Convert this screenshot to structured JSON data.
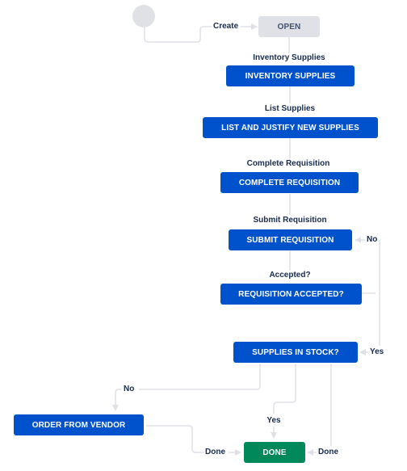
{
  "diagram": {
    "start_node": "start-circle",
    "statuses": {
      "open": {
        "label": "OPEN",
        "category": "todo"
      },
      "inventory": {
        "label": "INVENTORY SUPPLIES",
        "category": "inprogress"
      },
      "list": {
        "label": "LIST AND JUSTIFY NEW SUPPLIES",
        "category": "inprogress"
      },
      "complete": {
        "label": "COMPLETE REQUISITION",
        "category": "inprogress"
      },
      "submit": {
        "label": "SUBMIT REQUISITION",
        "category": "inprogress"
      },
      "accepted": {
        "label": "REQUISITION ACCEPTED?",
        "category": "inprogress"
      },
      "instock": {
        "label": "SUPPLIES IN STOCK?",
        "category": "inprogress"
      },
      "order": {
        "label": "ORDER FROM VENDOR",
        "category": "inprogress"
      },
      "done": {
        "label": "DONE",
        "category": "done"
      }
    },
    "transitions": {
      "create": {
        "label": "Create",
        "from": "start",
        "to": "open"
      },
      "inventory": {
        "label": "Inventory Supplies",
        "from": "open",
        "to": "inventory"
      },
      "list": {
        "label": "List Supplies",
        "from": "inventory",
        "to": "list"
      },
      "complete": {
        "label": "Complete Requisition",
        "from": "list",
        "to": "complete"
      },
      "submit": {
        "label": "Submit Requisition",
        "from": "complete",
        "to": "submit"
      },
      "accepted": {
        "label": "Accepted?",
        "from": "submit",
        "to": "accepted"
      },
      "rejected": {
        "label": "No",
        "from": "accepted",
        "to": "submit"
      },
      "yes_accepted": {
        "label": "Yes",
        "from": "accepted",
        "to": "instock"
      },
      "not_in_stock": {
        "label": "No",
        "from": "instock",
        "to": "order"
      },
      "in_stock": {
        "label": "Yes",
        "from": "instock",
        "to": "done"
      },
      "order_done": {
        "label": "Done",
        "from": "order",
        "to": "done"
      },
      "instock_done": {
        "label": "Done",
        "from": "instock",
        "to": "done"
      }
    },
    "colors": {
      "todo": "#dfe1e6",
      "inprogress": "#0052cc",
      "done": "#00875a",
      "edge": "#dfe1e6",
      "label": "#172b4d"
    }
  }
}
